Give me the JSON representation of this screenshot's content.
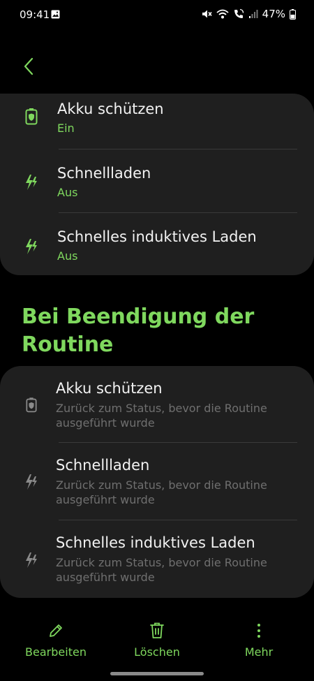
{
  "status_bar": {
    "time": "09:41",
    "battery_percent": "47%",
    "icons": [
      "photo-icon",
      "mute-icon",
      "wifi-calling-icon",
      "wifi-call-icon",
      "signal-icon",
      "battery-icon"
    ]
  },
  "colors": {
    "background": "#000000",
    "card": "#1f1f1f",
    "accent": "#7fd85e",
    "text": "#f2f2f2",
    "muted": "#6f6f6f"
  },
  "top_card": {
    "items": [
      {
        "title": "Akku schützen",
        "status": "Ein",
        "icon": "battery-protect-icon"
      },
      {
        "title": "Schnellladen",
        "status": "Aus",
        "icon": "fast-charge-icon"
      },
      {
        "title": "Schnelles induktives Laden",
        "status": "Aus",
        "icon": "fast-wireless-charge-icon"
      }
    ]
  },
  "end_section": {
    "title": "Bei Beendigung der Routine",
    "items": [
      {
        "title": "Akku schützen",
        "description": "Zurück zum Status, bevor die Routine ausgeführt wurde",
        "icon": "battery-protect-icon"
      },
      {
        "title": "Schnellladen",
        "description": "Zurück zum Status, bevor die Routine ausgeführt wurde",
        "icon": "fast-charge-icon"
      },
      {
        "title": "Schnelles induktives Laden",
        "description": "Zurück zum Status, bevor die Routine ausgeführt wurde",
        "icon": "fast-wireless-charge-icon"
      }
    ]
  },
  "bottom_bar": {
    "edit_label": "Bearbeiten",
    "delete_label": "Löschen",
    "more_label": "Mehr"
  }
}
